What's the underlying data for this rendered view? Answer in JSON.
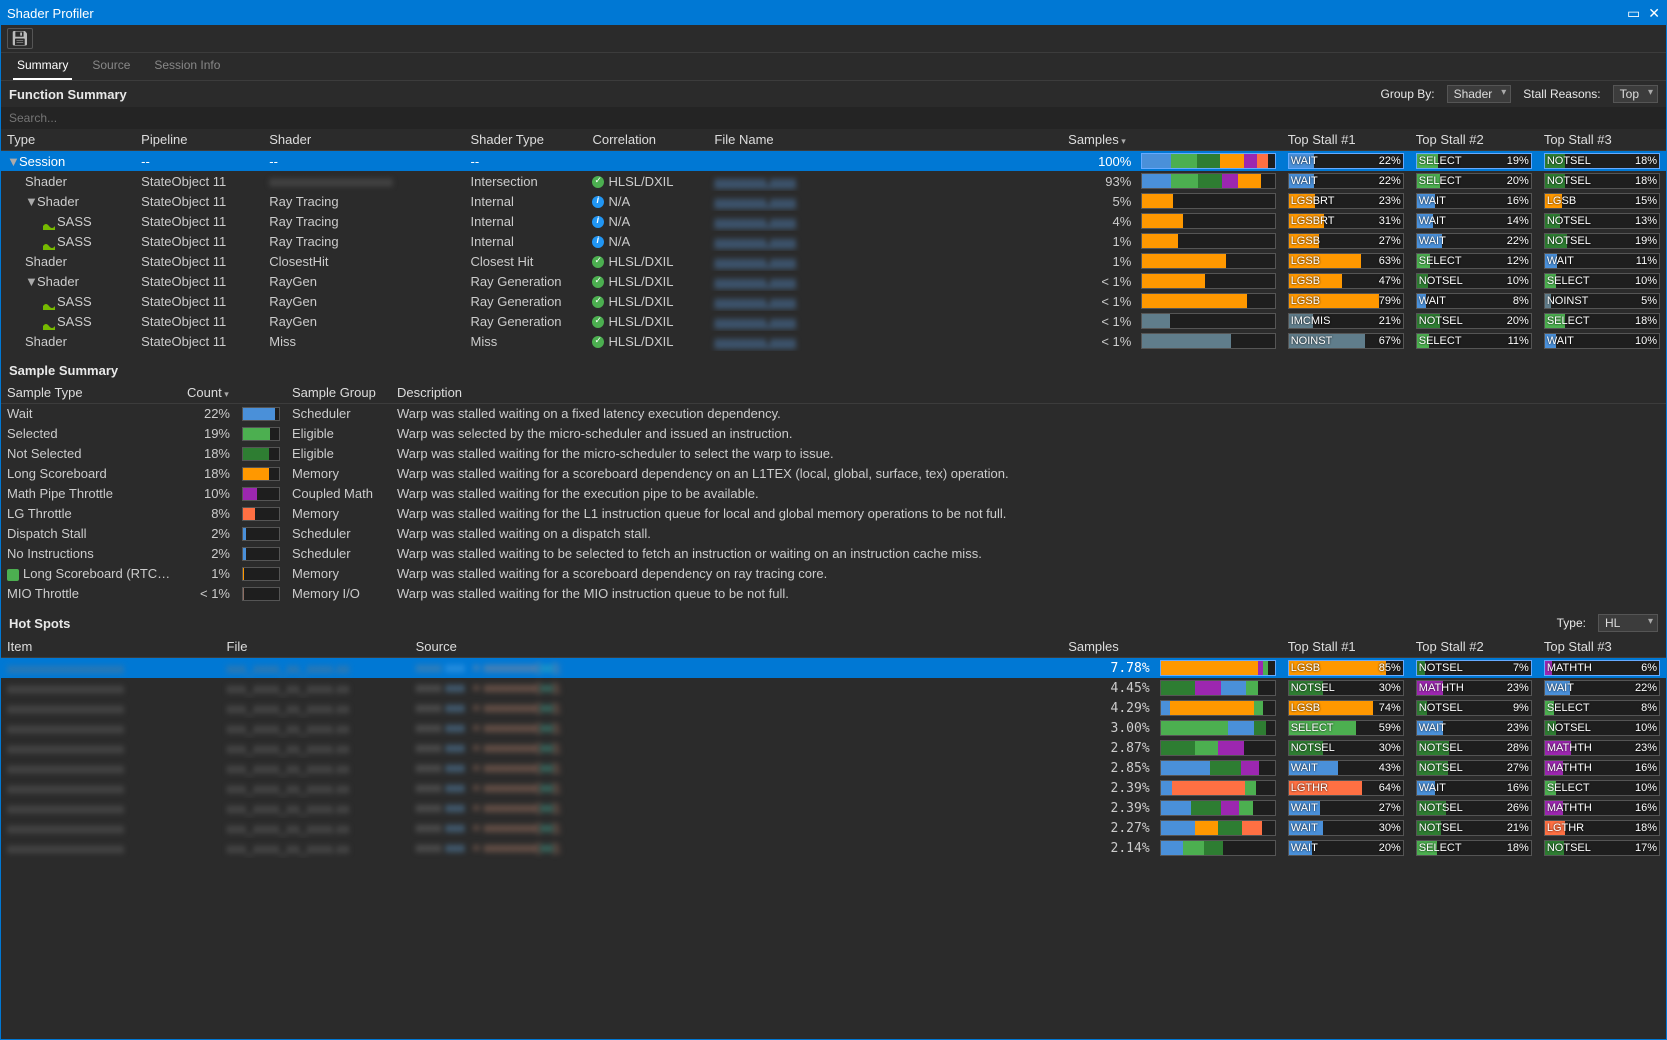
{
  "window": {
    "title": "Shader Profiler"
  },
  "tabs": [
    "Summary",
    "Source",
    "Session Info"
  ],
  "activeTab": 0,
  "section1": {
    "title": "Function Summary",
    "groupByLabel": "Group By:",
    "groupByValue": "Shader",
    "stallLabel": "Stall Reasons:",
    "stallValue": "Top",
    "searchPlaceholder": "Search..."
  },
  "funcCols": [
    "Type",
    "Pipeline",
    "Shader",
    "Shader Type",
    "Correlation",
    "File Name",
    "Samples",
    "",
    "Top Stall #1",
    "Top Stall #2",
    "Top Stall #3"
  ],
  "colors": {
    "WAIT": "#4a90d9",
    "SELECT": "#4caf50",
    "NOTSEL": "#2e7d32",
    "LGSB": "#ff9800",
    "LGSBRT": "#ff9800",
    "MATHTH": "#9c27b0",
    "IMCMIS": "#607d8b",
    "NOINST": "#607d8b",
    "LGTHR": "#ff7043"
  },
  "funcRows": [
    {
      "sel": true,
      "indent": 0,
      "exp": "▼",
      "type": "Session",
      "pipeline": "--",
      "shader": "--",
      "stype": "--",
      "corr": "",
      "file": "",
      "samples": "100%",
      "bar": [
        [
          "#4a90d9",
          22
        ],
        [
          "#4caf50",
          19
        ],
        [
          "#2e7d32",
          18
        ],
        [
          "#ff9800",
          18
        ],
        [
          "#9c27b0",
          10
        ],
        [
          "#ff7043",
          8
        ]
      ],
      "s1": [
        "WAIT",
        "22%",
        "#4a90d9",
        22
      ],
      "s2": [
        "SELECT",
        "19%",
        "#4caf50",
        19
      ],
      "s3": [
        "NOTSEL",
        "18%",
        "#2e7d32",
        18
      ]
    },
    {
      "indent": 1,
      "type": "Shader",
      "pipeline": "StateObject 11",
      "shader": "(redacted)",
      "stype": "Intersection",
      "corr": "ok",
      "corrText": "HLSL/DXIL",
      "file": "(redacted)",
      "samples": "93%",
      "bar": [
        [
          "#4a90d9",
          22
        ],
        [
          "#4caf50",
          20
        ],
        [
          "#2e7d32",
          18
        ],
        [
          "#9c27b0",
          12
        ],
        [
          "#ff9800",
          18
        ]
      ],
      "s1": [
        "WAIT",
        "22%",
        "#4a90d9",
        22
      ],
      "s2": [
        "SELECT",
        "20%",
        "#4caf50",
        20
      ],
      "s3": [
        "NOTSEL",
        "18%",
        "#2e7d32",
        18
      ]
    },
    {
      "indent": 1,
      "exp": "▼",
      "type": "Shader",
      "pipeline": "StateObject 11",
      "shader": "Ray Tracing",
      "stype": "Internal",
      "corr": "info",
      "corrText": "N/A",
      "file": "(redacted)",
      "samples": "5%",
      "bar": [
        [
          "#ff9800",
          23
        ]
      ],
      "s1": [
        "LGSBRT",
        "23%",
        "#ff9800",
        23
      ],
      "s2": [
        "WAIT",
        "16%",
        "#4a90d9",
        16
      ],
      "s3": [
        "LGSB",
        "15%",
        "#ff9800",
        15
      ]
    },
    {
      "indent": 2,
      "sass": true,
      "type": "SASS",
      "pipeline": "StateObject 11",
      "shader": "Ray Tracing",
      "stype": "Internal",
      "corr": "info",
      "corrText": "N/A",
      "file": "(redacted)",
      "samples": "4%",
      "bar": [
        [
          "#ff9800",
          31
        ]
      ],
      "s1": [
        "LGSBRT",
        "31%",
        "#ff9800",
        31
      ],
      "s2": [
        "WAIT",
        "14%",
        "#4a90d9",
        14
      ],
      "s3": [
        "NOTSEL",
        "13%",
        "#2e7d32",
        13
      ]
    },
    {
      "indent": 2,
      "sass": true,
      "type": "SASS",
      "pipeline": "StateObject 11",
      "shader": "Ray Tracing",
      "stype": "Internal",
      "corr": "info",
      "corrText": "N/A",
      "file": "(redacted)",
      "samples": "1%",
      "bar": [
        [
          "#ff9800",
          27
        ]
      ],
      "s1": [
        "LGSB",
        "27%",
        "#ff9800",
        27
      ],
      "s2": [
        "WAIT",
        "22%",
        "#4a90d9",
        22
      ],
      "s3": [
        "NOTSEL",
        "19%",
        "#2e7d32",
        19
      ]
    },
    {
      "indent": 1,
      "type": "Shader",
      "pipeline": "StateObject 11",
      "shader": "ClosestHit",
      "stype": "Closest Hit",
      "corr": "ok",
      "corrText": "HLSL/DXIL",
      "file": "(redacted)",
      "samples": "1%",
      "bar": [
        [
          "#ff9800",
          63
        ]
      ],
      "s1": [
        "LGSB",
        "63%",
        "#ff9800",
        63
      ],
      "s2": [
        "SELECT",
        "12%",
        "#4caf50",
        12
      ],
      "s3": [
        "WAIT",
        "11%",
        "#4a90d9",
        11
      ]
    },
    {
      "indent": 1,
      "exp": "▼",
      "type": "Shader",
      "pipeline": "StateObject 11",
      "shader": "RayGen",
      "stype": "Ray Generation",
      "corr": "ok",
      "corrText": "HLSL/DXIL",
      "file": "(redacted)",
      "samples": "< 1%",
      "bar": [
        [
          "#ff9800",
          47
        ]
      ],
      "s1": [
        "LGSB",
        "47%",
        "#ff9800",
        47
      ],
      "s2": [
        "NOTSEL",
        "10%",
        "#2e7d32",
        10
      ],
      "s3": [
        "SELECT",
        "10%",
        "#4caf50",
        10
      ]
    },
    {
      "indent": 2,
      "sass": true,
      "type": "SASS",
      "pipeline": "StateObject 11",
      "shader": "RayGen",
      "stype": "Ray Generation",
      "corr": "ok",
      "corrText": "HLSL/DXIL",
      "file": "(redacted)",
      "samples": "< 1%",
      "bar": [
        [
          "#ff9800",
          79
        ]
      ],
      "s1": [
        "LGSB",
        "79%",
        "#ff9800",
        79
      ],
      "s2": [
        "WAIT",
        "8%",
        "#4a90d9",
        8
      ],
      "s3": [
        "NOINST",
        "5%",
        "#607d8b",
        5
      ]
    },
    {
      "indent": 2,
      "sass": true,
      "type": "SASS",
      "pipeline": "StateObject 11",
      "shader": "RayGen",
      "stype": "Ray Generation",
      "corr": "ok",
      "corrText": "HLSL/DXIL",
      "file": "(redacted)",
      "samples": "< 1%",
      "bar": [
        [
          "#607d8b",
          21
        ]
      ],
      "s1": [
        "IMCMIS",
        "21%",
        "#607d8b",
        21
      ],
      "s2": [
        "NOTSEL",
        "20%",
        "#2e7d32",
        20
      ],
      "s3": [
        "SELECT",
        "18%",
        "#4caf50",
        18
      ]
    },
    {
      "indent": 1,
      "type": "Shader",
      "pipeline": "StateObject 11",
      "shader": "Miss",
      "stype": "Miss",
      "corr": "ok",
      "corrText": "HLSL/DXIL",
      "file": "(redacted)",
      "samples": "< 1%",
      "bar": [
        [
          "#607d8b",
          67
        ]
      ],
      "s1": [
        "NOINST",
        "67%",
        "#607d8b",
        67
      ],
      "s2": [
        "SELECT",
        "11%",
        "#4caf50",
        11
      ],
      "s3": [
        "WAIT",
        "10%",
        "#4a90d9",
        10
      ]
    }
  ],
  "sampleTitle": "Sample Summary",
  "sampleCols": [
    "Sample Type",
    "Count",
    "",
    "Sample Group",
    "Description"
  ],
  "sampleRows": [
    {
      "type": "Wait",
      "count": "22%",
      "color": "#4a90d9",
      "w": 22,
      "group": "Scheduler",
      "desc": "Warp was stalled waiting on a fixed latency execution dependency."
    },
    {
      "type": "Selected",
      "count": "19%",
      "color": "#4caf50",
      "w": 19,
      "group": "Eligible",
      "desc": "Warp was selected by the micro-scheduler and issued an instruction."
    },
    {
      "type": "Not Selected",
      "count": "18%",
      "color": "#2e7d32",
      "w": 18,
      "group": "Eligible",
      "desc": "Warp was stalled waiting for the micro-scheduler to select the warp to issue."
    },
    {
      "type": "Long Scoreboard",
      "count": "18%",
      "color": "#ff9800",
      "w": 18,
      "group": "Memory",
      "desc": "Warp was stalled waiting for a scoreboard dependency on an L1TEX (local, global, surface, tex) operation."
    },
    {
      "type": "Math Pipe Throttle",
      "count": "10%",
      "color": "#9c27b0",
      "w": 10,
      "group": "Coupled Math",
      "desc": "Warp was stalled waiting for the execution pipe to be available."
    },
    {
      "type": "LG Throttle",
      "count": "8%",
      "color": "#ff7043",
      "w": 8,
      "group": "Memory",
      "desc": "Warp was stalled waiting for the L1 instruction queue for local and global memory operations to be not full."
    },
    {
      "type": "Dispatch Stall",
      "count": "2%",
      "color": "#4a90d9",
      "w": 2,
      "group": "Scheduler",
      "desc": "Warp was stalled waiting on a dispatch stall."
    },
    {
      "type": "No Instructions",
      "count": "2%",
      "color": "#4a90d9",
      "w": 2,
      "group": "Scheduler",
      "desc": "Warp was stalled waiting to be selected to fetch an instruction or waiting on an instruction cache miss."
    },
    {
      "type": "Long Scoreboard (RTCore)",
      "shield": true,
      "count": "1%",
      "color": "#ff9800",
      "w": 1,
      "group": "Memory",
      "desc": "Warp was stalled waiting for a scoreboard dependency on ray tracing core."
    },
    {
      "type": "MIO Throttle",
      "count": "< 1%",
      "color": "#8d6e63",
      "w": 1,
      "group": "Memory I/O",
      "desc": "Warp was stalled waiting for the MIO instruction queue to be not full."
    }
  ],
  "hotTitle": "Hot Spots",
  "hotTypeLabel": "Type:",
  "hotTypeValue": "HL",
  "hotCols": [
    "Item",
    "File",
    "Source",
    "Samples",
    "",
    "Top Stall #1",
    "Top Stall #2",
    "Top Stall #3"
  ],
  "hotRows": [
    {
      "sel": true,
      "samples": "7.78%",
      "bar": [
        [
          "#ff9800",
          85
        ],
        [
          "#9c27b0",
          5
        ],
        [
          "#4caf50",
          4
        ]
      ],
      "s1": [
        "LGSB",
        "85%",
        "#ff9800",
        85
      ],
      "s2": [
        "NOTSEL",
        "7%",
        "#2e7d32",
        7
      ],
      "s3": [
        "MATHTH",
        "6%",
        "#9c27b0",
        6
      ]
    },
    {
      "samples": "4.45%",
      "bar": [
        [
          "#2e7d32",
          30
        ],
        [
          "#9c27b0",
          23
        ],
        [
          "#4a90d9",
          22
        ],
        [
          "#4caf50",
          10
        ]
      ],
      "s1": [
        "NOTSEL",
        "30%",
        "#2e7d32",
        30
      ],
      "s2": [
        "MATHTH",
        "23%",
        "#9c27b0",
        23
      ],
      "s3": [
        "WAIT",
        "22%",
        "#4a90d9",
        22
      ]
    },
    {
      "samples": "4.29%",
      "bar": [
        [
          "#4a90d9",
          8
        ],
        [
          "#ff9800",
          74
        ],
        [
          "#4caf50",
          8
        ]
      ],
      "s1": [
        "LGSB",
        "74%",
        "#ff9800",
        74
      ],
      "s2": [
        "NOTSEL",
        "9%",
        "#2e7d32",
        9
      ],
      "s3": [
        "SELECT",
        "8%",
        "#4caf50",
        8
      ]
    },
    {
      "samples": "3.00%",
      "bar": [
        [
          "#4caf50",
          59
        ],
        [
          "#4a90d9",
          23
        ],
        [
          "#2e7d32",
          10
        ]
      ],
      "s1": [
        "SELECT",
        "59%",
        "#4caf50",
        59
      ],
      "s2": [
        "WAIT",
        "23%",
        "#4a90d9",
        23
      ],
      "s3": [
        "NOTSEL",
        "10%",
        "#2e7d32",
        10
      ]
    },
    {
      "samples": "2.87%",
      "bar": [
        [
          "#2e7d32",
          30
        ],
        [
          "#4caf50",
          20
        ],
        [
          "#9c27b0",
          23
        ]
      ],
      "s1": [
        "NOTSEL",
        "30%",
        "#2e7d32",
        30
      ],
      "s2": [
        "NOTSEL",
        "28%",
        "#2e7d32",
        28
      ],
      "s3": [
        "MATHTH",
        "23%",
        "#9c27b0",
        23
      ]
    },
    {
      "samples": "2.85%",
      "bar": [
        [
          "#4a90d9",
          43
        ],
        [
          "#2e7d32",
          27
        ],
        [
          "#9c27b0",
          16
        ]
      ],
      "s1": [
        "WAIT",
        "43%",
        "#4a90d9",
        43
      ],
      "s2": [
        "NOTSEL",
        "27%",
        "#2e7d32",
        27
      ],
      "s3": [
        "MATHTH",
        "16%",
        "#9c27b0",
        16
      ]
    },
    {
      "samples": "2.39%",
      "bar": [
        [
          "#4a90d9",
          10
        ],
        [
          "#ff7043",
          64
        ],
        [
          "#4caf50",
          10
        ]
      ],
      "s1": [
        "LGTHR",
        "64%",
        "#ff7043",
        64
      ],
      "s2": [
        "WAIT",
        "16%",
        "#4a90d9",
        16
      ],
      "s3": [
        "SELECT",
        "10%",
        "#4caf50",
        10
      ]
    },
    {
      "samples": "2.39%",
      "bar": [
        [
          "#4a90d9",
          27
        ],
        [
          "#2e7d32",
          26
        ],
        [
          "#9c27b0",
          16
        ],
        [
          "#4caf50",
          12
        ]
      ],
      "s1": [
        "WAIT",
        "27%",
        "#4a90d9",
        27
      ],
      "s2": [
        "NOTSEL",
        "26%",
        "#2e7d32",
        26
      ],
      "s3": [
        "MATHTH",
        "16%",
        "#9c27b0",
        16
      ]
    },
    {
      "samples": "2.27%",
      "bar": [
        [
          "#4a90d9",
          30
        ],
        [
          "#ff9800",
          20
        ],
        [
          "#2e7d32",
          21
        ],
        [
          "#ff7043",
          18
        ]
      ],
      "s1": [
        "WAIT",
        "30%",
        "#4a90d9",
        30
      ],
      "s2": [
        "NOTSEL",
        "21%",
        "#2e7d32",
        21
      ],
      "s3": [
        "LGTHR",
        "18%",
        "#ff7043",
        18
      ]
    },
    {
      "samples": "2.14%",
      "bar": [
        [
          "#4a90d9",
          20
        ],
        [
          "#4caf50",
          18
        ],
        [
          "#2e7d32",
          17
        ]
      ],
      "s1": [
        "WAIT",
        "20%",
        "#4a90d9",
        20
      ],
      "s2": [
        "SELECT",
        "18%",
        "#4caf50",
        18
      ],
      "s3": [
        "NOTSEL",
        "17%",
        "#2e7d32",
        17
      ]
    }
  ]
}
